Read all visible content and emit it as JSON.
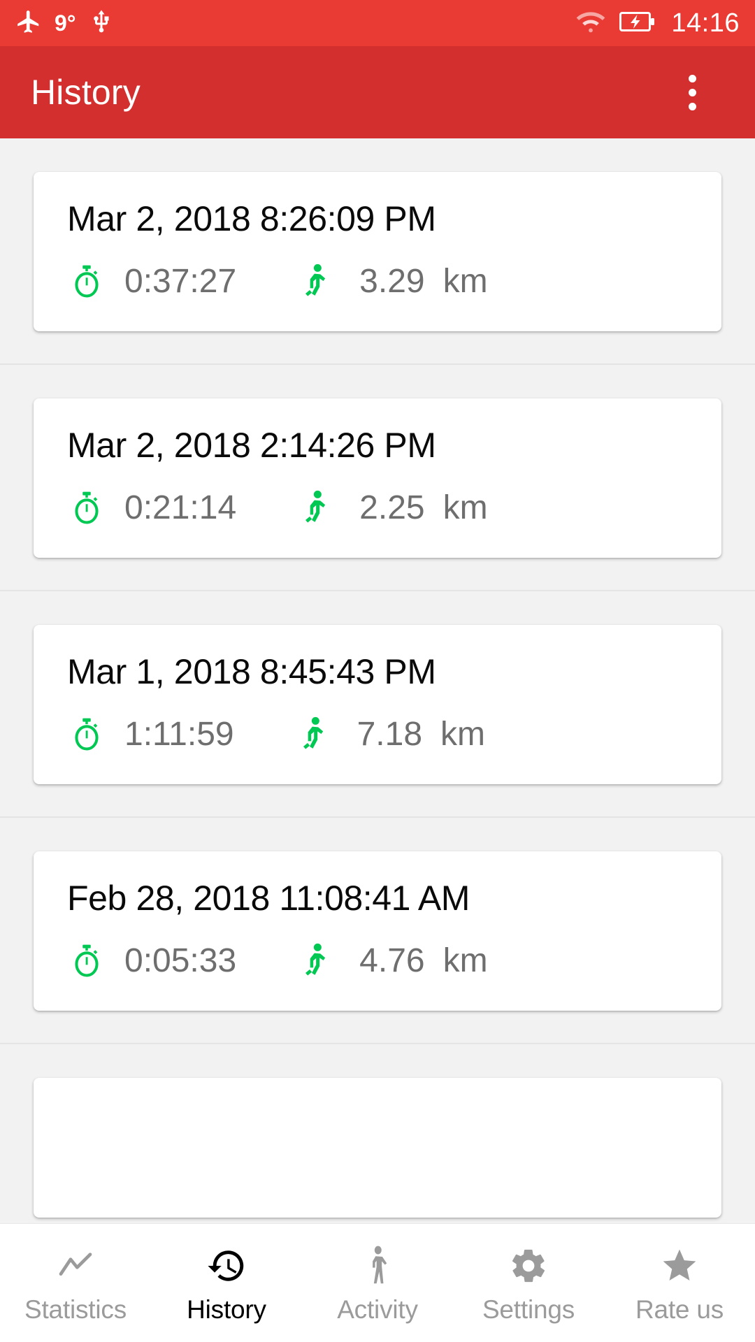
{
  "colors": {
    "status_bar": "#ea3a34",
    "app_bar": "#d32f2f",
    "accent_green": "#00c853",
    "value_gray": "#6e6e6e",
    "nav_inactive": "#9b9b9b",
    "nav_active": "#000000",
    "page_background": "#f2f2f2",
    "card_background": "#ffffff"
  },
  "status_bar": {
    "airplane_icon": "airplane-mode-icon",
    "temperature": "9°",
    "usb_icon": "usb-icon",
    "wifi_icon": "wifi-icon",
    "battery_icon": "battery-charging-icon",
    "clock": "14:16"
  },
  "app_bar": {
    "title": "History",
    "overflow_icon": "overflow-menu-icon"
  },
  "list": {
    "duration_icon": "stopwatch-icon",
    "distance_icon": "running-person-icon",
    "distance_unit": "km",
    "entries": [
      {
        "date": "Mar 2, 2018 8:26:09 PM",
        "duration": "0:37:27",
        "distance": "3.29",
        "unit": "km"
      },
      {
        "date": "Mar 2, 2018 2:14:26 PM",
        "duration": "0:21:14",
        "distance": "2.25",
        "unit": "km"
      },
      {
        "date": "Mar 1, 2018 8:45:43 PM",
        "duration": "1:11:59",
        "distance": "7.18",
        "unit": "km"
      },
      {
        "date": "Feb 28, 2018 11:08:41 AM",
        "duration": "0:05:33",
        "distance": "4.76",
        "unit": "km"
      }
    ]
  },
  "bottom_nav": {
    "items": [
      {
        "label": "Statistics",
        "icon": "line-chart-icon",
        "active": false
      },
      {
        "label": "History",
        "icon": "history-clock-icon",
        "active": true
      },
      {
        "label": "Activity",
        "icon": "walking-person-icon",
        "active": false
      },
      {
        "label": "Settings",
        "icon": "gear-icon",
        "active": false
      },
      {
        "label": "Rate us",
        "icon": "star-icon",
        "active": false
      }
    ]
  }
}
